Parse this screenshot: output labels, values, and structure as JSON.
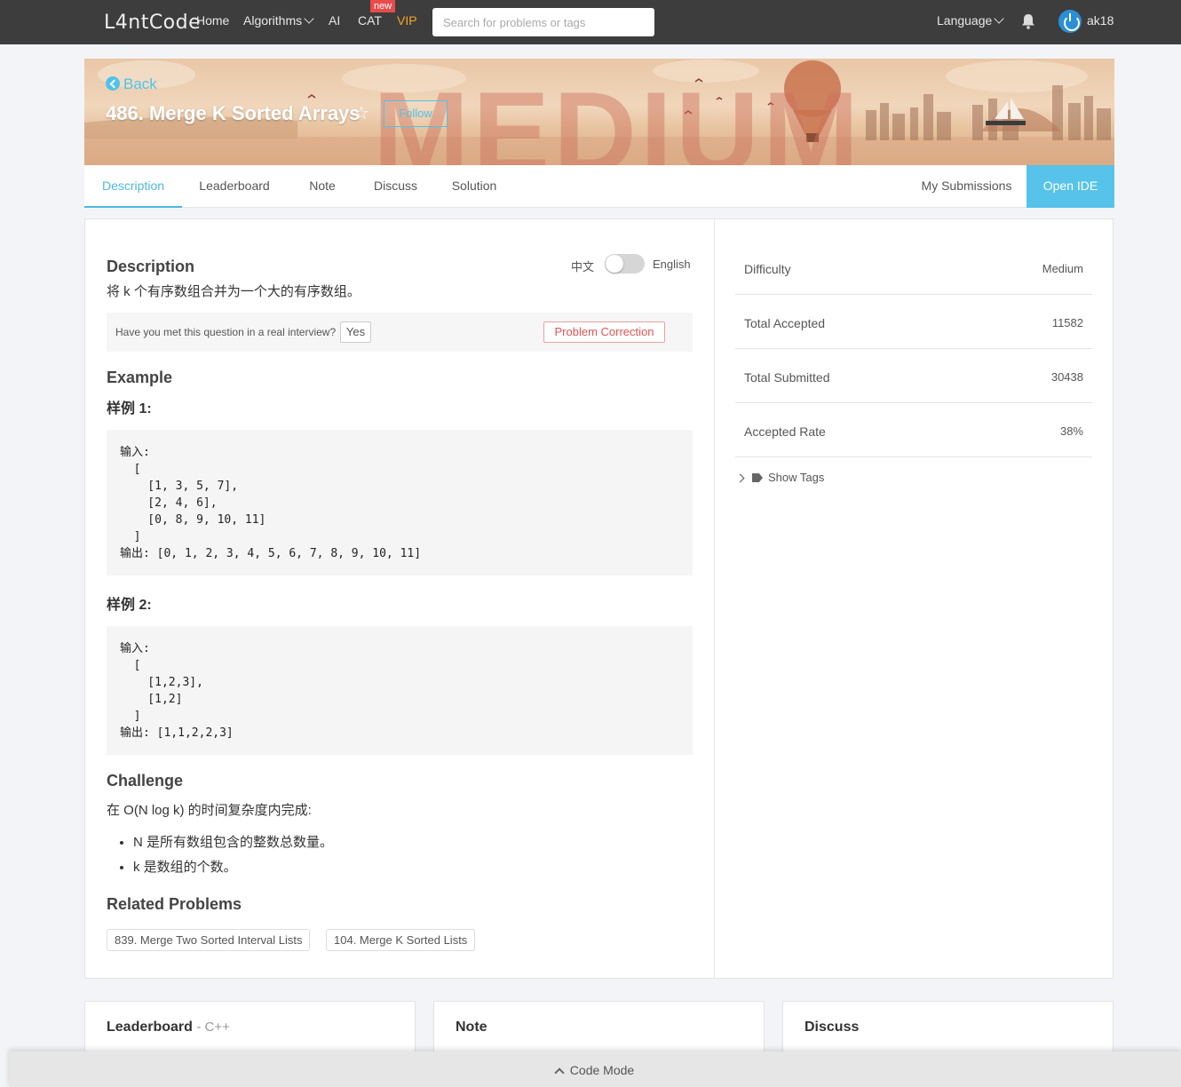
{
  "nav": {
    "logo": "L4ntCode",
    "links": [
      "Home",
      "Algorithms",
      "AI",
      "CAT",
      "VIP"
    ],
    "new_badge": "new",
    "search_placeholder": "Search for problems or tags",
    "language": "Language",
    "username": "ak18"
  },
  "banner": {
    "back": "Back",
    "title": "486. Merge K Sorted Arrays",
    "follow": "Follow",
    "difficulty_watermark": "MEDIUM"
  },
  "tabs": [
    "Description",
    "Leaderboard",
    "Note",
    "Discuss",
    "Solution"
  ],
  "tabs_right": {
    "submissions": "My Submissions",
    "open_ide": "Open IDE"
  },
  "description": {
    "heading": "Description",
    "lang_zh": "中文",
    "lang_en": "English",
    "text": "将 k 个有序数组合并为一个大的有序数组。",
    "interview_q": "Have you met this question in a real interview?",
    "yes": "Yes",
    "problem_correction": "Problem Correction",
    "example_heading": "Example",
    "sample1_label": "样例 1:",
    "sample1_code": "输入:\n  [\n    [1, 3, 5, 7],\n    [2, 4, 6],\n    [0, 8, 9, 10, 11]\n  ]\n输出: [0, 1, 2, 3, 4, 5, 6, 7, 8, 9, 10, 11]",
    "sample2_label": "样例 2:",
    "sample2_code": "输入:\n  [\n    [1,2,3],\n    [1,2]\n  ]\n输出: [1,1,2,2,3]",
    "challenge_heading": "Challenge",
    "challenge_text": "在 O(N log k) 的时间复杂度内完成:",
    "challenge_bullets": [
      "N 是所有数组包含的整数总数量。",
      "k 是数组的个数。"
    ],
    "related_heading": "Related Problems",
    "related": [
      "839. Merge Two Sorted Interval Lists",
      "104. Merge K Sorted Lists"
    ]
  },
  "stats": [
    {
      "label": "Difficulty",
      "value": "Medium"
    },
    {
      "label": "Total Accepted",
      "value": "11582"
    },
    {
      "label": "Total Submitted",
      "value": "30438"
    },
    {
      "label": "Accepted Rate",
      "value": "38%"
    }
  ],
  "show_tags": "Show Tags",
  "cards": {
    "leaderboard": "Leaderboard",
    "leaderboard_sub": "- C++",
    "note": "Note",
    "discuss": "Discuss"
  },
  "code_mode": "Code Mode"
}
